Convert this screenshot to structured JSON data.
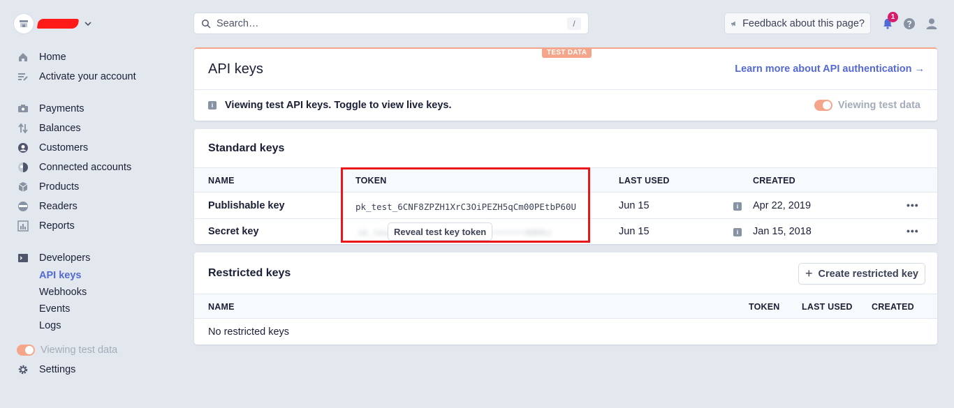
{
  "sidebar": {
    "primary": [
      {
        "label": "Home",
        "icon": "home-icon"
      },
      {
        "label": "Activate your account",
        "icon": "checklist-icon"
      }
    ],
    "main": [
      {
        "label": "Payments",
        "icon": "payments-icon"
      },
      {
        "label": "Balances",
        "icon": "balances-icon"
      },
      {
        "label": "Customers",
        "icon": "customers-icon"
      },
      {
        "label": "Connected accounts",
        "icon": "connected-accounts-icon"
      },
      {
        "label": "Products",
        "icon": "products-icon"
      },
      {
        "label": "Readers",
        "icon": "readers-icon"
      },
      {
        "label": "Reports",
        "icon": "reports-icon"
      }
    ],
    "developers": {
      "label": "Developers",
      "icon": "terminal-icon",
      "items": [
        "API keys",
        "Webhooks",
        "Events",
        "Logs"
      ],
      "active": "API keys"
    },
    "test_toggle_label": "Viewing test data",
    "settings_label": "Settings"
  },
  "topbar": {
    "search_placeholder": "Search…",
    "search_shortcut": "/",
    "feedback_label": "Feedback about this page?",
    "notification_count": "1"
  },
  "header_card": {
    "badge": "TEST DATA",
    "title": "API keys",
    "link": "Learn more about API authentication →",
    "info_text": "Viewing test API keys. Toggle to view live keys.",
    "toggle_label": "Viewing test data"
  },
  "standard_keys": {
    "title": "Standard keys",
    "columns": [
      "NAME",
      "TOKEN",
      "LAST USED",
      "CREATED"
    ],
    "rows": [
      {
        "name": "Publishable key",
        "token": "pk_test_6CNF8ZPZH1XrC3OiPEZH5qCm00PEtbP60U",
        "last_used": "Jun 15",
        "created": "Apr 22, 2019"
      },
      {
        "name": "Secret key",
        "token": "sk_test_••••••••••••••••••••••••00Hhc",
        "reveal_label": "Reveal test key token",
        "last_used": "Jun 15",
        "created": "Jan 15, 2018"
      }
    ],
    "more_label": "•••"
  },
  "restricted_keys": {
    "title": "Restricted keys",
    "create_label": "Create restricted key",
    "columns": [
      "NAME",
      "TOKEN",
      "LAST USED",
      "CREATED"
    ],
    "empty_text": "No restricted keys"
  },
  "colors": {
    "accent": "#5469d4",
    "test_orange": "#f5a68a",
    "highlight_red": "#e8161b",
    "background": "#e3e8ee"
  }
}
